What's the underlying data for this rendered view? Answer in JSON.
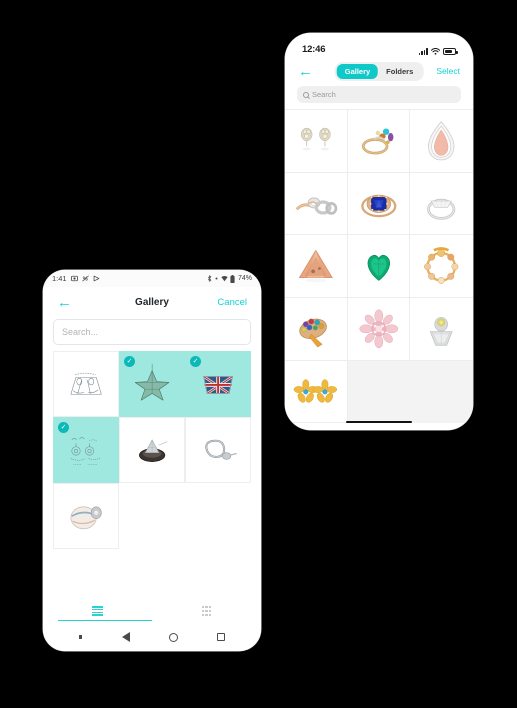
{
  "background_color": "#000000",
  "accent_colors": {
    "teal": "#18cfd4",
    "teal_strong": "#0fc9c9",
    "selection_mint": "#9fe8e0",
    "check_badge": "#0cb8b8"
  },
  "ios_phone": {
    "status_bar": {
      "time": "12:46",
      "icons": [
        "cellular-signal-icon",
        "wifi-icon",
        "battery-icon"
      ]
    },
    "nav": {
      "back_icon": "back-arrow-icon",
      "segments": [
        {
          "label": "Gallery",
          "active": true
        },
        {
          "label": "Folders",
          "active": false
        }
      ],
      "select_label": "Select"
    },
    "search": {
      "icon": "search-icon",
      "placeholder": "Search",
      "value": ""
    },
    "grid": {
      "columns": 3,
      "items": [
        {
          "name": "diamond-cluster-earrings",
          "art": "earrings-cluster"
        },
        {
          "name": "multi-gem-cocktail-ring",
          "art": "multi-gem-ring"
        },
        {
          "name": "pear-pink-diamond-pendant",
          "art": "pear-pendant"
        },
        {
          "name": "rose-gold-diamond-ring-pair",
          "art": "ring-pair"
        },
        {
          "name": "blue-sapphire-halo-ring",
          "art": "blue-halo-ring"
        },
        {
          "name": "white-gold-solitaire-ring",
          "art": "solitaire-ring"
        },
        {
          "name": "peach-trillion-gemstone",
          "art": "trillion-gem"
        },
        {
          "name": "emerald-heart-gemstone",
          "art": "heart-emerald"
        },
        {
          "name": "gold-pearl-bracelet",
          "art": "gold-bracelet"
        },
        {
          "name": "rainbow-gem-cocktail-ring",
          "art": "rainbow-ring"
        },
        {
          "name": "pink-diamond-flower-ring",
          "art": "flower-ring"
        },
        {
          "name": "yellow-diamond-signet-ring",
          "art": "signet-ring"
        },
        {
          "name": "gold-flower-stud-earrings",
          "art": "flower-studs"
        },
        {
          "name": "empty-grid-slot",
          "art": "empty"
        },
        {
          "name": "empty-grid-slot",
          "art": "empty"
        }
      ]
    },
    "home_indicator": "home-indicator"
  },
  "android_phone": {
    "status_bar": {
      "time": "1:41",
      "left_icons": [
        "screenshot-icon",
        "silent-mode-icon",
        "play-icon"
      ],
      "right_icons": [
        "bluetooth-icon",
        "wifi-icon",
        "battery-icon"
      ],
      "battery_percent": "74%"
    },
    "appbar": {
      "back_icon": "back-arrow-icon",
      "title": "Gallery",
      "cancel_label": "Cancel"
    },
    "search": {
      "placeholder": "Search...",
      "value": ""
    },
    "grid": {
      "columns": 3,
      "items": [
        {
          "name": "sketch-jewellery-drawing",
          "art": "sketch-a",
          "selected": false
        },
        {
          "name": "star-brooch-sketch",
          "art": "star",
          "selected": true
        },
        {
          "name": "union-jack-flag-pin",
          "art": "flag",
          "selected": true
        },
        {
          "name": "earrings-design-sheet",
          "art": "sketch-b",
          "selected": true
        },
        {
          "name": "dark-stone-ring",
          "art": "dark-ring",
          "selected": false
        },
        {
          "name": "silver-pendant-loop",
          "art": "loop-pendant",
          "selected": false
        },
        {
          "name": "shell-cameo-brooch",
          "art": "shell",
          "selected": false
        }
      ]
    },
    "bottom_tabs": [
      {
        "name": "list-view-tab",
        "icon": "list-icon",
        "active": true
      },
      {
        "name": "grid-view-tab",
        "icon": "grid-icon",
        "active": false
      }
    ],
    "nav_bar": [
      "dot-icon",
      "back-triangle-icon",
      "home-circle-icon",
      "recents-square-icon"
    ]
  }
}
